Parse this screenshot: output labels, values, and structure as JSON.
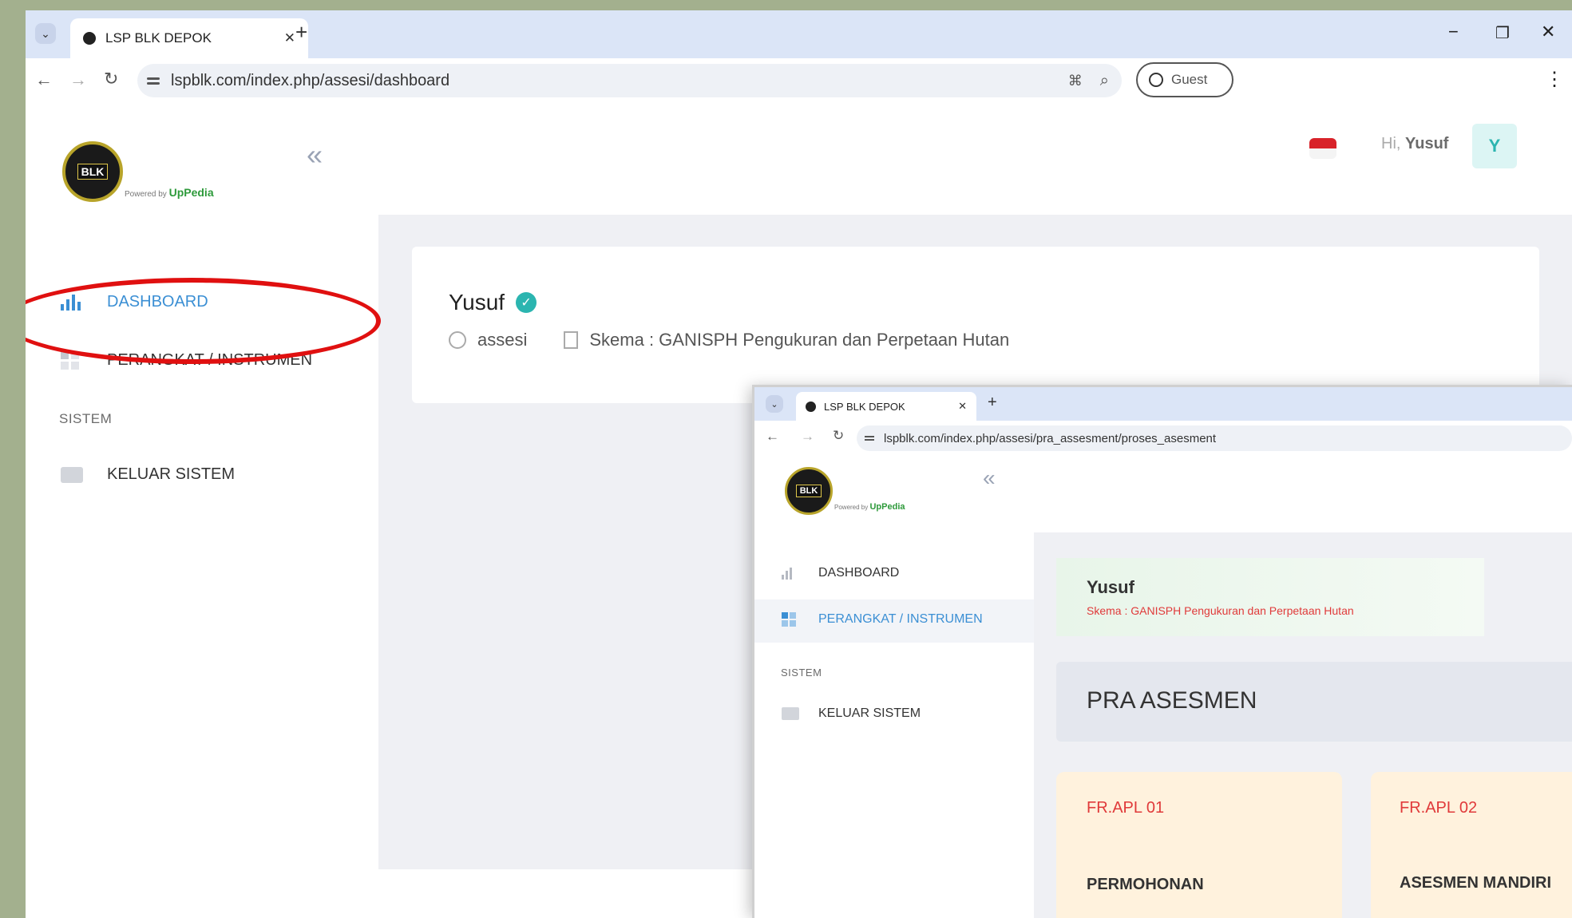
{
  "main": {
    "tab": {
      "title": "LSP BLK DEPOK",
      "close": "✕"
    },
    "new_tab": "+",
    "url": "lspblk.com/index.php/assesi/dashboard",
    "profile_label": "Guest",
    "window_controls": {
      "minimize": "−",
      "restore": "❐",
      "close": "✕"
    },
    "logo": {
      "badge": "BLK",
      "powered_by": "Powered by",
      "brand": "UpPedia"
    },
    "sidebar": {
      "items": [
        {
          "label": "DASHBOARD"
        },
        {
          "label": "PERANGKAT / INSTRUMEN"
        }
      ],
      "section": "SISTEM",
      "logout": "KELUAR SISTEM"
    },
    "header": {
      "greeting": "Hi,",
      "user": "Yusuf",
      "avatar": "Y"
    },
    "profile": {
      "name": "Yusuf",
      "role": "assesi",
      "scheme": "Skema : GANISPH Pengukuran dan Perpetaan Hutan"
    },
    "colors": {
      "accent": "#3b8fd4",
      "annotation": "#e01010",
      "teal": "#2bb5b0"
    }
  },
  "inner": {
    "tab": {
      "title": "LSP BLK DEPOK",
      "close": "✕"
    },
    "new_tab": "+",
    "url": "lspblk.com/index.php/assesi/pra_assesment/proses_asesment",
    "logo": {
      "badge": "BLK",
      "powered_by": "Powered by",
      "brand": "UpPedia"
    },
    "sidebar": {
      "items": [
        {
          "label": "DASHBOARD"
        },
        {
          "label": "PERANGKAT / INSTRUMEN"
        }
      ],
      "section": "SISTEM",
      "logout": "KELUAR SISTEM"
    },
    "banner": {
      "name": "Yusuf",
      "scheme": "Skema : GANISPH Pengukuran dan Perpetaan Hutan"
    },
    "section_title": "PRA ASESMEN",
    "cards": [
      {
        "code": "FR.APL 01",
        "title": "PERMOHONAN"
      },
      {
        "code": "FR.APL 02",
        "title": "ASESMEN MANDIRI"
      }
    ]
  }
}
